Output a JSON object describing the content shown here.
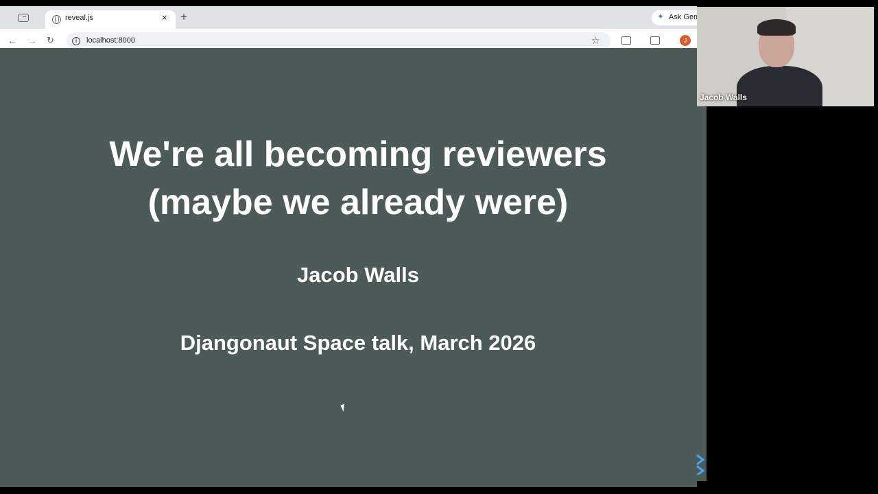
{
  "browser": {
    "tab": {
      "title": "reveal.js",
      "close_glyph": "×"
    },
    "new_tab_glyph": "+",
    "gemini_label": "Ask Gemini",
    "address": "localhost:8000",
    "profile_initial": "J",
    "icons": [
      "tab-switcher-icon",
      "globe-icon",
      "back-arrow-icon",
      "forward-arrow-icon",
      "reload-icon",
      "info-icon",
      "bookmark-star-icon",
      "extensions-icon",
      "side-panel-icon",
      "profile-avatar"
    ]
  },
  "slide": {
    "title_line1": "We're all becoming reviewers",
    "title_line2": "(maybe we already were)",
    "author": "Jacob Walls",
    "event": "Djangonaut Space talk, March 2026",
    "background": "#4d5b58",
    "controls_color": "#42a5f5"
  },
  "webcam": {
    "name": "Jacob Walls"
  }
}
